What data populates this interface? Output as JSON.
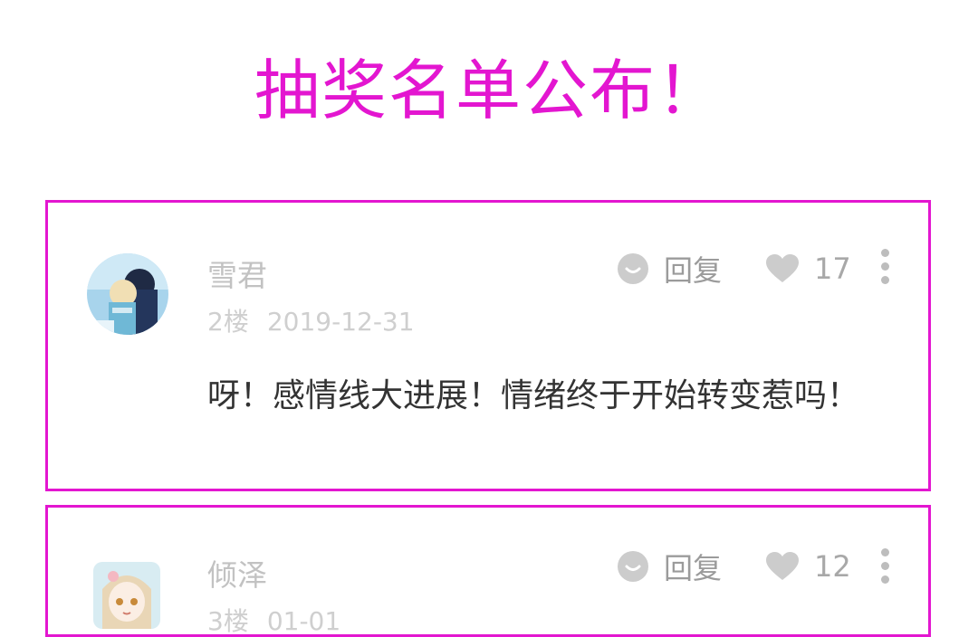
{
  "title": "抽奖名单公布！",
  "colors": {
    "accent": "#e316d0",
    "username": "#c2c2c2",
    "meta": "#cfcfcf",
    "icon": "#cccccc",
    "content": "#333333"
  },
  "comments": [
    {
      "username": "雪君",
      "floor": "2楼",
      "date": "2019-12-31",
      "reply_label": "回复",
      "likes": "17",
      "content": "呀！感情线大进展！情绪终于开始转变惹吗！",
      "avatar_icon": "anime-couple-avatar"
    },
    {
      "username": "倾泽",
      "floor": "3楼",
      "date": "01-01",
      "reply_label": "回复",
      "likes": "12",
      "avatar_icon": "anime-girl-avatar"
    }
  ],
  "icons": {
    "reply": "reply-bubble-icon",
    "like": "heart-icon",
    "more": "more-vertical-icon"
  }
}
